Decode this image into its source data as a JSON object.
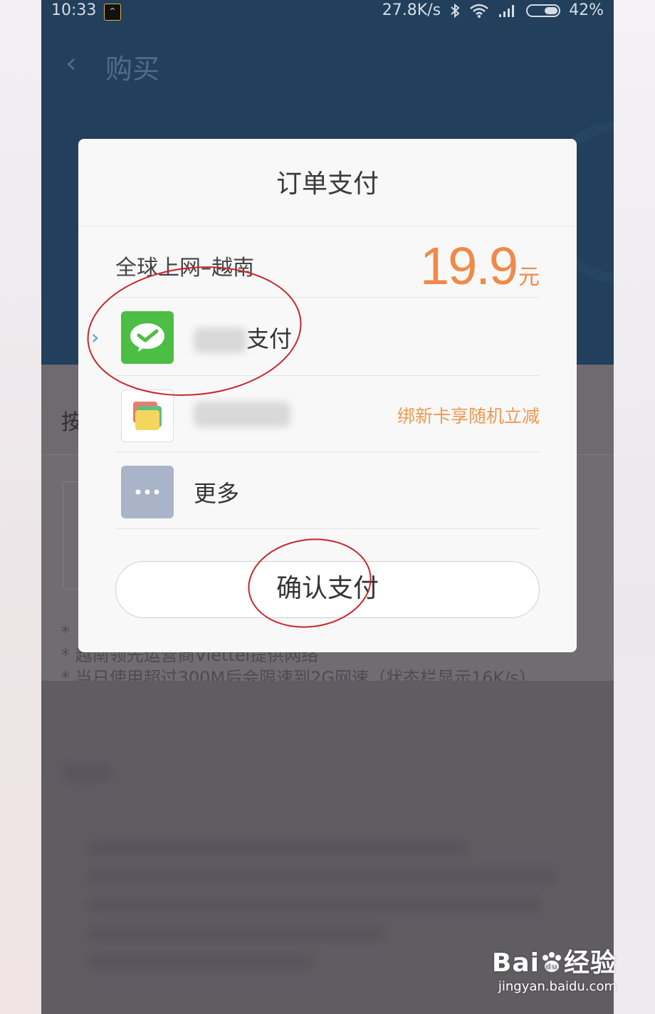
{
  "status_bar": {
    "time": "10:33",
    "network_speed": "27.8K/s",
    "battery_percent": "42%"
  },
  "nav": {
    "back_icon": "chevron-left-icon",
    "title": "购买"
  },
  "background": {
    "row_label": "按",
    "notes": [
      "*",
      "* 越南领先运营商Viettel提供网络",
      "* 当日使用超过300M后会限速到2G网速（状态栏显示16K/s）"
    ]
  },
  "dialog": {
    "title": "订单支付",
    "product_name": "全球上网–越南",
    "price": "19.9",
    "price_unit": "元",
    "payment_methods": [
      {
        "label_suffix": "支付",
        "icon": "wechat-pay-icon",
        "selected": true,
        "promo": ""
      },
      {
        "label_suffix": "",
        "icon": "bank-card-icon",
        "selected": false,
        "promo": "绑新卡享随机立减"
      },
      {
        "label_suffix": "更多",
        "icon": "more-icon",
        "selected": false,
        "promo": ""
      }
    ],
    "confirm_label": "确认支付"
  },
  "watermark": {
    "brand_prefix": "Bai",
    "brand_suffix": "经验",
    "url": "jingyan.baidu.com"
  },
  "colors": {
    "header_bg": "#223f5b",
    "price": "#ef8a49",
    "promo": "#eb9a4f",
    "wechat_green": "#4cbd45",
    "annotation_red": "#c8252b",
    "selected_chevron": "#4f96d6"
  }
}
